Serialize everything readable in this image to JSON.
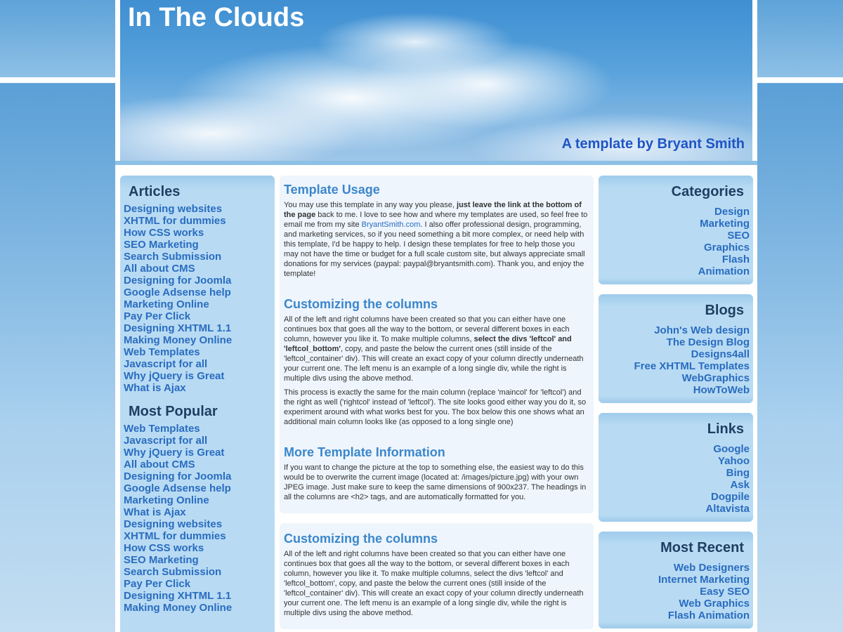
{
  "header": {
    "title": "In The Clouds",
    "tagline": "A template by Bryant Smith"
  },
  "left": {
    "articles_heading": "Articles",
    "articles": [
      "Designing websites",
      "XHTML for dummies",
      "How CSS works",
      "SEO Marketing",
      "Search Submission",
      "All about CMS",
      "Designing for Joomla",
      "Google Adsense help",
      "Marketing Online",
      "Pay Per Click",
      "Designing XHTML 1.1",
      "Making Money Online",
      "Web Templates",
      "Javascript for all",
      "Why jQuery is Great",
      "What is Ajax"
    ],
    "popular_heading": "Most Popular",
    "popular": [
      "Web Templates",
      "Javascript for all",
      "Why jQuery is Great",
      "All about CMS",
      "Designing for Joomla",
      "Google Adsense help",
      "Marketing Online",
      "What is Ajax",
      "Designing websites",
      "XHTML for dummies",
      "How CSS works",
      "SEO Marketing",
      "Search Submission",
      "Pay Per Click",
      "Designing XHTML 1.1",
      "Making Money Online"
    ]
  },
  "main": {
    "usage_heading": "Template Usage",
    "usage_p1_a": "You may use this template in any way you please, ",
    "usage_p1_bold": "just leave the link at the bottom of the page",
    "usage_p1_b": " back to me. I love to see how and where my templates are used, so feel free to email me from my site ",
    "usage_p1_link": "BryantSmith.com",
    "usage_p1_c": ". I also offer professional design, programming, and marketing services, so if you need something a bit more complex, or need help with this template, I'd be happy to help. I design these templates for free to help those you may not have the time or budget for a full scale custom site, but always appreciate small donations for my services (paypal: paypal@bryantsmith.com). Thank you, and enjoy the template!",
    "columns_heading": "Customizing the columns",
    "columns_p1_a": "All of the left and right columns have been created so that you can either have one continues box that goes all the way to the bottom, or several different boxes in each column, however you like it. To make multiple columns, ",
    "columns_p1_bold": "select the divs 'leftcol' and 'leftcol_bottom'",
    "columns_p1_b": ", copy, and paste the below the current ones (still inside of the 'leftcol_container' div). This will create an exact copy of your column directly underneath your current one. The left menu is an example of a long single div, while the right is multiple divs using the above method.",
    "columns_p2": "This process is exactly the same for the main column (replace 'maincol' for 'leftcol') and the right as well ('rightcol' instead of 'leftcol'). The site looks good either way you do it, so experiment around with what works best for you. The box below this one shows what an additional main column looks like (as opposed to a long single one)",
    "more_heading": "More Template Information",
    "more_p1": "If you want to change the picture at the top to something else, the easiest way to do this would be to overwrite the current image (located at: /images/picture.jpg) with your own JPEG image. Just make sure to keep the same dimensions of 900x237. The headings in all the columns are <h2> tags, and are automatically formatted for you.",
    "box2_heading": "Customizing the columns",
    "box2_p1": "All of the left and right columns have been created so that you can either have one continues box that goes all the way to the bottom, or several different boxes in each column, however you like it. To make multiple columns, select the divs 'leftcol' and 'leftcol_bottom', copy, and paste the below the current ones (still inside of the 'leftcol_container' div). This will create an exact copy of your column directly underneath your current one. The left menu is an example of a long single div, while the right is multiple divs using the above method."
  },
  "right": {
    "categories_heading": "Categories",
    "categories": [
      "Design",
      "Marketing",
      "SEO",
      "Graphics",
      "Flash",
      "Animation"
    ],
    "blogs_heading": "Blogs",
    "blogs": [
      "John's Web design",
      "The Design Blog",
      "Designs4all",
      "Free XHTML Templates",
      "WebGraphics",
      "HowToWeb"
    ],
    "links_heading": "Links",
    "links": [
      "Google",
      "Yahoo",
      "Bing",
      "Ask",
      "Dogpile",
      "Altavista"
    ],
    "recent_heading": "Most Recent",
    "recent": [
      "Web Designers",
      "Internet Marketing",
      "Easy SEO",
      "Web Graphics",
      "Flash Animation"
    ]
  }
}
